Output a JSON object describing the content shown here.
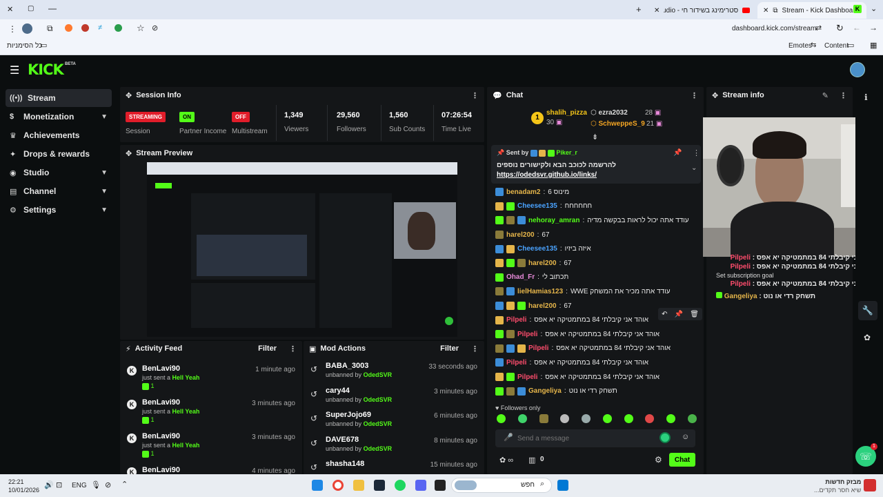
{
  "browser": {
    "tabs": [
      {
        "label": "סטרימינג בשידור חי - Studio",
        "active": false
      },
      {
        "label": "Stream - Kick Dashboard",
        "active": true
      }
    ],
    "url": "dashboard.kick.com/stream",
    "bookmarks_label": "כל הסימניות",
    "right_bookmarks": [
      "Emotes",
      "Content"
    ]
  },
  "app": {
    "logo": "KICK",
    "logo_tag": "BETA"
  },
  "sidebar": {
    "items": [
      {
        "label": "Stream",
        "icon": "broadcast-icon",
        "active": true,
        "expandable": false
      },
      {
        "label": "Monetization",
        "icon": "dollar-icon",
        "active": false,
        "expandable": true
      },
      {
        "label": "Achievements",
        "icon": "trophy-icon",
        "active": false,
        "expandable": false
      },
      {
        "label": "Drops & rewards",
        "icon": "gift-icon",
        "active": false,
        "expandable": false
      },
      {
        "label": "Studio",
        "icon": "studio-icon",
        "active": false,
        "expandable": true
      },
      {
        "label": "Channel",
        "icon": "channel-icon",
        "active": false,
        "expandable": true
      },
      {
        "label": "Settings",
        "icon": "gear-icon",
        "active": false,
        "expandable": true
      }
    ]
  },
  "session": {
    "title": "Session Info",
    "streaming_badge": "STREAMING",
    "session_label": "Session",
    "partner_badge": "ON",
    "partner_label": "Partner Income",
    "multistream_badge": "OFF",
    "multistream_label": "Multistream",
    "viewers": "1,349",
    "viewers_label": "Viewers",
    "followers": "29,560",
    "followers_label": "Followers",
    "subs": "1,560",
    "subs_label": "Sub Counts",
    "time": "07:26:54",
    "time_label": "Time Live"
  },
  "preview": {
    "title": "Stream Preview"
  },
  "activity": {
    "title": "Activity Feed",
    "filter": "Filter",
    "items": [
      {
        "name": "BenLavi90",
        "text": "just sent a",
        "gift": "Hell Yeah",
        "count": "1",
        "time": "1 minute ago"
      },
      {
        "name": "BenLavi90",
        "text": "just sent a",
        "gift": "Hell Yeah",
        "count": "1",
        "time": "3 minutes ago"
      },
      {
        "name": "BenLavi90",
        "text": "just sent a",
        "gift": "Hell Yeah",
        "count": "1",
        "time": "3 minutes ago"
      },
      {
        "name": "BenLavi90",
        "text": "",
        "gift": "",
        "count": "",
        "time": "4 minutes ago"
      }
    ]
  },
  "mod": {
    "title": "Mod Actions",
    "filter": "Filter",
    "items": [
      {
        "name": "BABA_3003",
        "action": "unbanned by",
        "by": "OdedSVR",
        "time": "33 seconds ago"
      },
      {
        "name": "cary44",
        "action": "unbanned by",
        "by": "OdedSVR",
        "time": "3 minutes ago"
      },
      {
        "name": "SuperJojo69",
        "action": "unbanned by",
        "by": "OdedSVR",
        "time": "6 minutes ago"
      },
      {
        "name": "DAVE678",
        "action": "unbanned by",
        "by": "OdedSVR",
        "time": "8 minutes ago"
      },
      {
        "name": "shasha148",
        "action": "",
        "by": "",
        "time": "15 minutes ago"
      }
    ]
  },
  "chat": {
    "title": "Chat",
    "leaders": [
      {
        "rank": "1",
        "name": "shalih_pizza",
        "count": "30"
      },
      {
        "name": "ezra2032",
        "count": "28"
      },
      {
        "name": "SchweppeS_9",
        "count": "21"
      }
    ],
    "pinned": {
      "sent_by": "Sent by",
      "user": "Piker_r",
      "text": "להרשמה לכוכב הבא ולקישורים נוספים",
      "link": "https://odedsvr.github.io/links/"
    },
    "messages": [
      {
        "user": "benadam2",
        "color": "#e5b54a",
        "text": "מינוס 6"
      },
      {
        "user": "Cheesee135",
        "color": "#4aa3ff",
        "text": "חחחחחח"
      },
      {
        "user": "nehoray_amran",
        "color": "#53fc18",
        "text": "עודד אתה יכול לראות בבקשה מדיה"
      },
      {
        "user": "harel200",
        "color": "#e5b54a",
        "text": "67"
      },
      {
        "user": "Cheesee135",
        "color": "#4aa3ff",
        "text": "איזה ביזיו"
      },
      {
        "user": "harel200",
        "color": "#e5b54a",
        "text": "67"
      },
      {
        "user": "Ohad_Fr",
        "color": "#e78ad9",
        "text": "תכתוב לי"
      },
      {
        "user": "lielHamias123",
        "color": "#e5b54a",
        "text": "עודד אתה מכיר את המשחק WWE"
      },
      {
        "user": "harel200",
        "color": "#e5b54a",
        "text": "67"
      },
      {
        "user": "Pilpeli",
        "color": "#ff4d6d",
        "text": "אוהד אני קיבלתי 84 במתמטיקה יא אפס"
      },
      {
        "user": "Pilpeli",
        "color": "#ff4d6d",
        "text": "אוהד אני קיבלתי 84 במתמטיקה יא אפס"
      },
      {
        "user": "Pilpeli",
        "color": "#ff4d6d",
        "text": "אוהד אני קיבלתי 84 במתמטיקה יא אפס"
      },
      {
        "user": "Pilpeli",
        "color": "#ff4d6d",
        "text": "אוהד אני קיבלתי 84 במתמטיקה יא אפס"
      },
      {
        "user": "Pilpeli",
        "color": "#ff4d6d",
        "text": "אוהד אני קיבלתי 84 במתמטיקה יא אפס"
      },
      {
        "user": "Gangeliya",
        "color": "#e5b54a",
        "text": "תשחק רדי או נוט"
      }
    ],
    "followers_only": "Followers only",
    "placeholder": "Send a message",
    "footer_count": "0",
    "chat_button": "Chat"
  },
  "streaminfo": {
    "title": "Stream info",
    "overlay_lines": [
      {
        "user": "Pilpeli",
        "text": "אוהד אני קיבלתי 84 במתמטיקה יא אפס"
      },
      {
        "user": "Pilpeli",
        "text": "אוהד אני קיבלתי 84 במתמטיקה יא אפס"
      },
      {
        "user": "Pilpeli",
        "text": "אוהד אני קיבלתי 84 במתמטיקה יא אפס"
      },
      {
        "user": "Gangeliya",
        "text": "תשחק רדי או נוט"
      }
    ],
    "subgoal": "Set subscription goal"
  },
  "taskbar": {
    "time": "22:21",
    "date": "10/01/2026",
    "lang": "ENG",
    "search": "חפש",
    "news_title": "מבזק חדשות",
    "news_sub": "שיא חסר תקדים..."
  }
}
